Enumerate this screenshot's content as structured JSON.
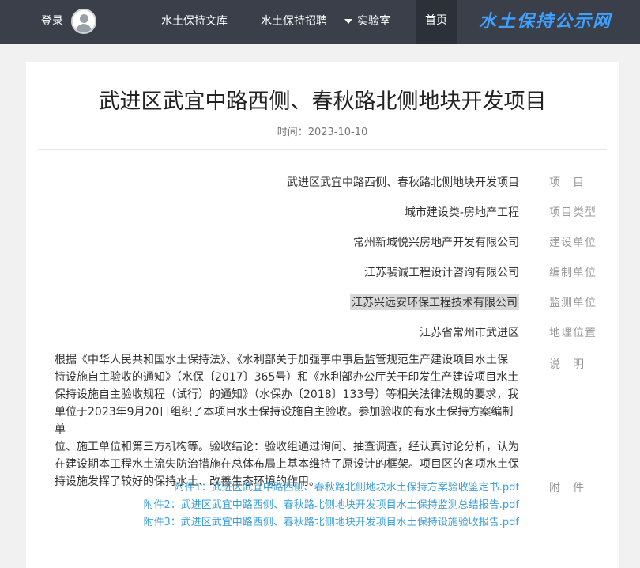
{
  "header": {
    "brand": "水土保持公示网",
    "nav": {
      "home": "首页",
      "lab": "实验室",
      "jobs": "水土保持招聘",
      "docs": "水土保持文库"
    },
    "login": "登录"
  },
  "article": {
    "title": "武进区武宜中路西侧、春秋路北侧地块开发项目",
    "date": "时间：2023-10-10",
    "fields": [
      {
        "label": "项　目",
        "value": "武进区武宜中路西侧、春秋路北侧地块开发项目"
      },
      {
        "label": "项目类型",
        "value": "城市建设类-房地产工程"
      },
      {
        "label": "建设单位",
        "value": "常州新城悦兴房地产开发有限公司"
      },
      {
        "label": "编制单位",
        "value": "江苏裴诚工程设计咨询有限公司"
      },
      {
        "label": "监测单位",
        "value": "江苏兴远安环保工程技术有限公司"
      },
      {
        "label": "地理位置",
        "value": "江苏省常州市武进区"
      }
    ],
    "description_label": "说　明",
    "description_lines": [
      "根据《中华人民共和国水土保持法》、《水利部关于加强事中事后监管规范生产建设项目水土保",
      "持设施自主验收的通知》（水保〔2017〕365号）和《水利部办公厅关于印发生产建设项目水土",
      "保持设施自主验收规程（试行）的通知》（水保办〔2018〕133号）等相关法律法规的要求，我",
      "单位于2023年9月20日组织了本项目水土保持设施自主验收。参加验收的有水土保持方案编制单",
      "位、施工单位和第三方机构等。验收结论：验收组通过询问、抽查调查，经认真讨论分析，认为",
      "在建设期本工程水土流失防治措施在总体布局上基本维持了原设计的框架。项目区的各项水土保",
      "持设施发挥了较好的保持水土、改善生态环境的作用。"
    ],
    "attachments_label": "附　件",
    "attachments": [
      "附件1：武进区武宜中路西侧、春秋路北侧地块水土保持方案验收鉴定书.pdf",
      "附件2：武进区武宜中路西侧、春秋路北侧地块开发项目水土保持监测总结报告.pdf",
      "附件3：武进区武宜中路西侧、春秋路北侧地块开发项目水土保持设施验收报告.pdf"
    ]
  }
}
